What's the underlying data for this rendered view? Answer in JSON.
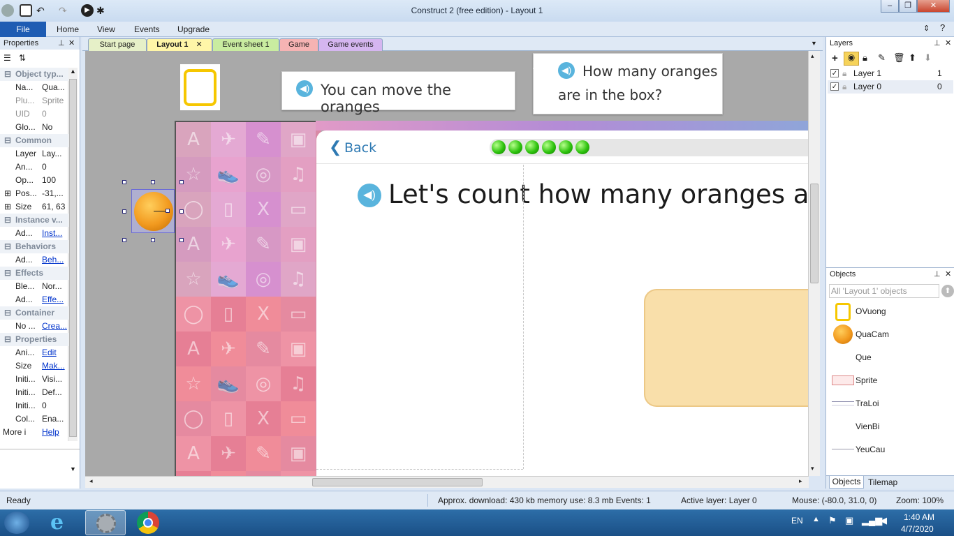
{
  "window": {
    "title": "Construct 2  (free edition) - Layout 1",
    "min": "–",
    "max": "❐",
    "close": "✕"
  },
  "menu": {
    "file": "File",
    "items": [
      "Home",
      "View",
      "Events",
      "Upgrade"
    ]
  },
  "tabs": [
    "Start page",
    "Layout 1",
    "Event sheet 1",
    "Game",
    "Game events"
  ],
  "tab_close": "✕",
  "properties": {
    "title": "Properties",
    "rows": [
      {
        "type": "cat",
        "label": "Object typ..."
      },
      {
        "type": "row",
        "key": "Na...",
        "val": "Qua...",
        "style": ""
      },
      {
        "type": "row",
        "key": "Plu...",
        "val": "Sprite",
        "style": "gray"
      },
      {
        "type": "row",
        "key": "UID",
        "val": "0",
        "style": "gray"
      },
      {
        "type": "row",
        "key": "Glo...",
        "val": "No",
        "style": ""
      },
      {
        "type": "cat",
        "label": "Common"
      },
      {
        "type": "row",
        "key": "Layer",
        "val": "Lay...",
        "style": ""
      },
      {
        "type": "row",
        "key": "An...",
        "val": "0",
        "style": ""
      },
      {
        "type": "row",
        "key": "Op...",
        "val": "100",
        "style": ""
      },
      {
        "type": "row",
        "key": "Pos...",
        "val": "-31,...",
        "style": "",
        "expand": true
      },
      {
        "type": "row",
        "key": "Size",
        "val": "61, 63",
        "style": "",
        "expand": true
      },
      {
        "type": "cat",
        "label": "Instance v..."
      },
      {
        "type": "row",
        "key": "Ad...",
        "val": "Inst...",
        "style": "link"
      },
      {
        "type": "cat",
        "label": "Behaviors"
      },
      {
        "type": "row",
        "key": "Ad...",
        "val": "Beh...",
        "style": "link"
      },
      {
        "type": "cat",
        "label": "Effects"
      },
      {
        "type": "row",
        "key": "Ble...",
        "val": "Nor...",
        "style": ""
      },
      {
        "type": "row",
        "key": "Ad...",
        "val": "Effe...",
        "style": "link"
      },
      {
        "type": "cat",
        "label": "Container"
      },
      {
        "type": "row",
        "key": "No ...",
        "val": "Crea...",
        "style": "link"
      },
      {
        "type": "cat",
        "label": "Properties"
      },
      {
        "type": "row",
        "key": "Ani...",
        "val": "Edit",
        "style": "link"
      },
      {
        "type": "row",
        "key": "Size",
        "val": "Mak...",
        "style": "link"
      },
      {
        "type": "row",
        "key": "Initi...",
        "val": "Visi...",
        "style": ""
      },
      {
        "type": "row",
        "key": "Initi...",
        "val": "Def...",
        "style": ""
      },
      {
        "type": "row",
        "key": "Initi...",
        "val": "0",
        "style": ""
      },
      {
        "type": "row",
        "key": "Col...",
        "val": "Ena...",
        "style": ""
      },
      {
        "type": "more",
        "key": "More i...",
        "val": "Help",
        "style": "link"
      }
    ]
  },
  "layout": {
    "bubble1": "You can move the oranges",
    "bubble2_line1": "How many oranges",
    "bubble2_line2": "are in the box?",
    "back": "Back",
    "heading": "Let's count how many oranges are",
    "progress_balls": 6,
    "tile_icons": [
      "A",
      "✈",
      "✎",
      "▣",
      "☆",
      "👟",
      "◎",
      "♫",
      "◯",
      "▯",
      "X",
      "▭"
    ]
  },
  "layers": {
    "title": "Layers",
    "items": [
      {
        "name": "Layer 1",
        "index": "1",
        "checked": true
      },
      {
        "name": "Layer 0",
        "index": "0",
        "checked": true
      }
    ]
  },
  "objects": {
    "title": "Objects",
    "filter": "All 'Layout 1' objects",
    "items": [
      "OVuong",
      "QuaCam",
      "Que",
      "Sprite",
      "TraLoi",
      "VienBi",
      "YeuCau"
    ],
    "tabs": [
      "Objects",
      "Tilemap"
    ]
  },
  "status": {
    "ready": "Ready",
    "download": "Approx. download: 430 kb  memory use: 8.3 mb  Events: 1",
    "layer": "Active layer: Layer 0",
    "mouse": "Mouse: (-80.0, 31.0, 0)",
    "zoom": "Zoom: 100%"
  },
  "taskbar": {
    "lang": "EN",
    "time": "1:40 AM",
    "date": "4/7/2020"
  },
  "colors": {
    "accent": "#1e5cb3",
    "bubble_icon": "#59b4dd",
    "box": "#f9dfaa",
    "orange": "#f29a1f"
  }
}
